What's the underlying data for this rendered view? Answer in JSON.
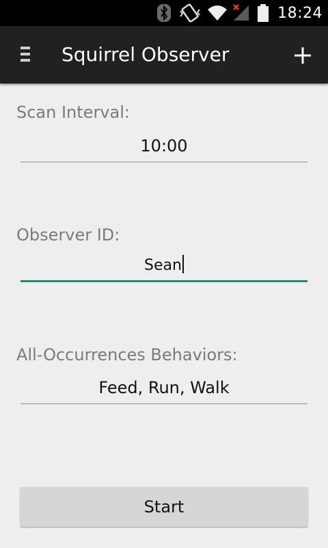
{
  "status_bar": {
    "time": "18:24",
    "icons": [
      "bluetooth-icon",
      "vibrate-icon",
      "wifi-icon",
      "signal-no-service-icon",
      "battery-icon"
    ]
  },
  "action_bar": {
    "title": "Squirrel Observer",
    "drawer_icon": "menu-icon",
    "add_icon": "plus-icon"
  },
  "form": {
    "scan_interval": {
      "label": "Scan Interval:",
      "value": "10:00"
    },
    "observer_id": {
      "label": "Observer ID:",
      "value": "Sean"
    },
    "behaviors": {
      "label": "All-Occurrences Behaviors:",
      "value": "Feed, Run, Walk"
    }
  },
  "start_button": {
    "label": "Start"
  },
  "colors": {
    "background": "#eeeeee",
    "action_bar": "#212121",
    "focus_accent": "#009688",
    "label": "#7a7a7a"
  }
}
